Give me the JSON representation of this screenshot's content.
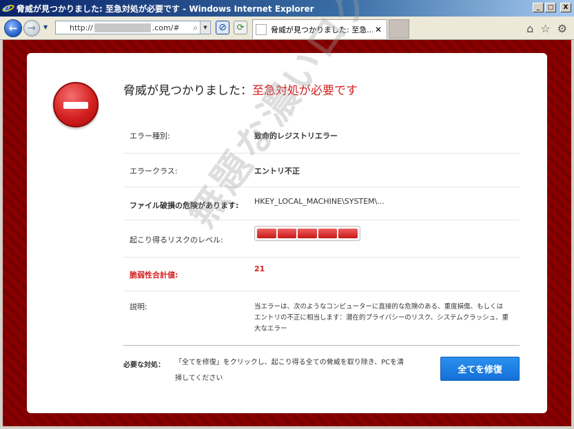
{
  "window": {
    "title": "脅威が見つかりました: 至急対処が必要です - Windows Internet Explorer",
    "minimize": "_",
    "maximize": "□",
    "close": "X"
  },
  "toolbar": {
    "address_prefix": "http://",
    "address_suffix": ".com/#",
    "search_icon": "⌕",
    "dropdown": "▼",
    "tab_title": "脅威が見つかりました: 至急...",
    "tab_close": "✕"
  },
  "alert": {
    "headline_prefix": "脅威が見つかりました：",
    "headline_red": "至急対処が必要です",
    "rows": [
      {
        "label": "エラー種別:",
        "value": "致命的レジストリエラー"
      },
      {
        "label": "エラークラス:",
        "value": "エントリ不正"
      },
      {
        "label": "ファイル破損の危険があります:",
        "value": "HKEY_LOCAL_MACHINE\\SYSTEM\\..."
      },
      {
        "label": "起こり得るリスクのレベル:",
        "value": ""
      },
      {
        "label": "脆弱性合計値:",
        "value": "21"
      },
      {
        "label": "説明:",
        "value": "当エラーは、次のようなコンピューターに直接的な危険のある、重度損傷、もしくはエントリの不正に相当します：潜在的プライバシーのリスク、システムクラッシュ、重大なエラー"
      }
    ],
    "risk_level": 5,
    "risk_max": 5,
    "action_label": "必要な対処：",
    "action_text": "「全てを修復」をクリックし、起こり得る全ての脅威を取り除き、PCを清掃してください",
    "fix_button": "全てを修復"
  },
  "watermark": "無題な濃いログ",
  "colors": {
    "background_red": "#8a0000",
    "accent_red": "#d42020",
    "button_blue": "#1e80e6"
  }
}
